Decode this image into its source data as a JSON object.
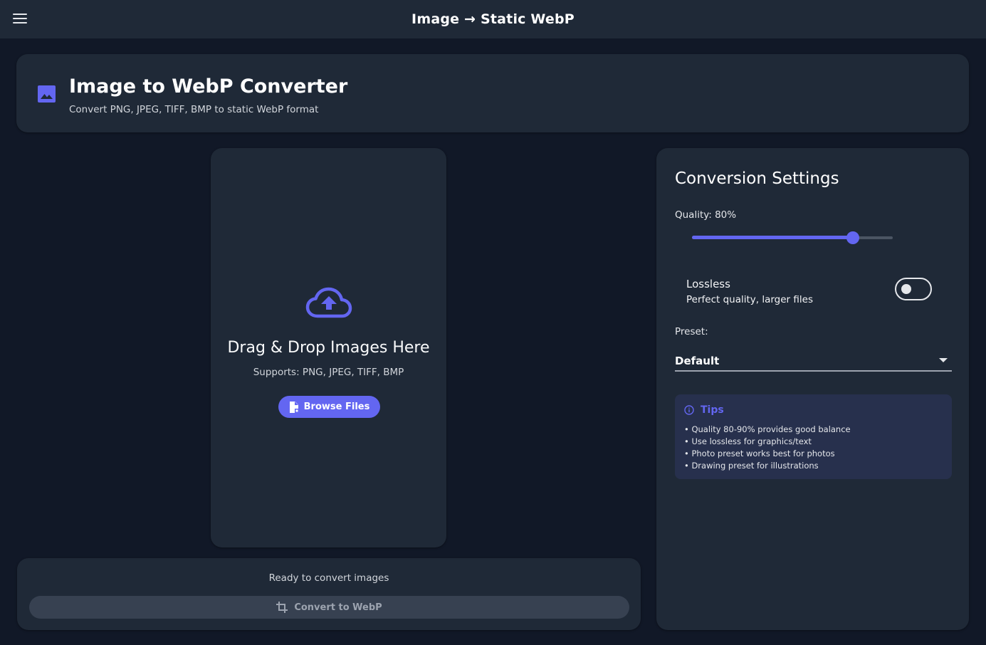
{
  "app_bar": {
    "title": "Image → Static WebP",
    "menu_icon": "hamburger-menu-icon"
  },
  "header": {
    "icon": "image-icon",
    "title": "Image to WebP Converter",
    "subtitle": "Convert PNG, JPEG, TIFF, BMP to static WebP format"
  },
  "drop_zone": {
    "icon": "cloud-upload-icon",
    "title": "Drag & Drop Images Here",
    "subtitle": "Supports: PNG, JPEG, TIFF, BMP",
    "browse_label": "Browse Files",
    "browse_icon": "file-icon"
  },
  "status": {
    "text": "Ready to convert images",
    "convert_label": "Convert to WebP",
    "convert_icon": "crop-icon"
  },
  "settings": {
    "title": "Conversion Settings",
    "quality_label": "Quality: 80%",
    "quality_value": 0.8,
    "lossless": {
      "title": "Lossless",
      "subtitle": "Perfect quality, larger files",
      "enabled": false
    },
    "preset_label": "Preset:",
    "preset_value": "Default",
    "tips": {
      "icon": "info-icon",
      "title": "Tips",
      "items": [
        "• Quality 80-90% provides good balance",
        "• Use lossless for graphics/text",
        "• Photo preset works best for photos",
        "• Drawing preset for illustrations"
      ]
    }
  },
  "colors": {
    "accent": "#6366f1",
    "background": "#111827",
    "surface": "#1f2937",
    "tips_surface": "#27304d",
    "disabled_button": "#374151"
  }
}
